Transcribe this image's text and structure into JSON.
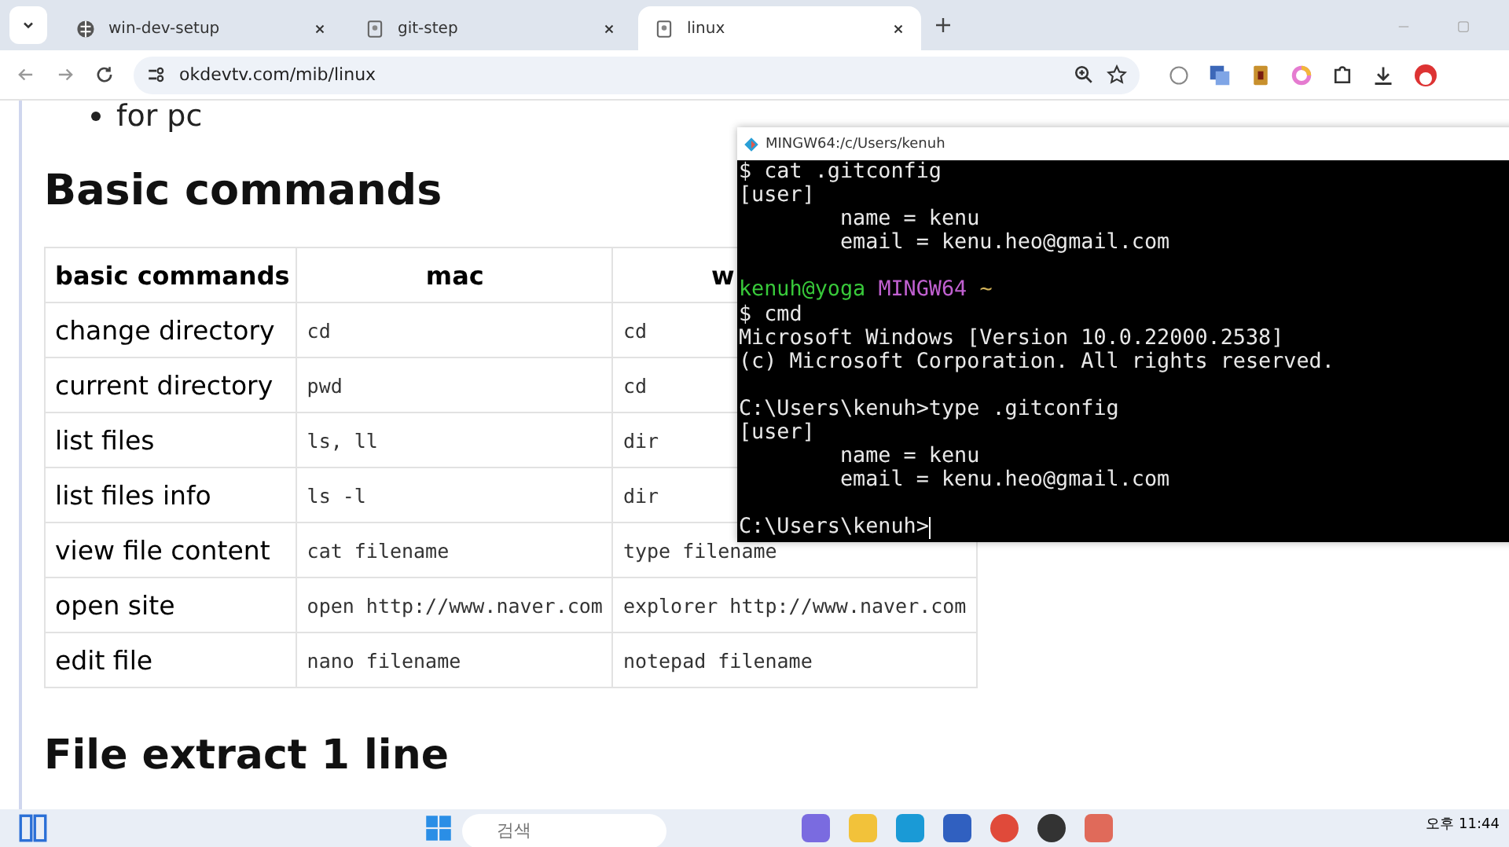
{
  "browser": {
    "tabs": [
      {
        "title": "win-dev-setup",
        "selected": false
      },
      {
        "title": "git-step",
        "selected": false
      },
      {
        "title": "linux",
        "selected": true
      }
    ],
    "address": "okdevtv.com/mib/linux"
  },
  "page": {
    "bullet": "for pc",
    "heading": "Basic commands",
    "table": {
      "columns": [
        "basic commands",
        "mac",
        "w"
      ],
      "rows": [
        [
          "change directory",
          "cd",
          "cd"
        ],
        [
          "current directory",
          "pwd",
          "cd"
        ],
        [
          "list files",
          "ls, ll",
          "dir"
        ],
        [
          "list files info",
          "ls -l",
          "dir"
        ],
        [
          "view file content",
          "cat filename",
          "type filename"
        ],
        [
          "open site",
          "open http://www.naver.com",
          "explorer http://www.naver.com"
        ],
        [
          "edit file",
          "nano filename",
          "notepad filename"
        ]
      ]
    },
    "heading_2": "File extract 1 line"
  },
  "terminal": {
    "title": "MINGW64:/c/Users/kenuh",
    "lines": [
      {
        "kind": "text",
        "text": "$ cat .gitconfig"
      },
      {
        "kind": "text",
        "text": "[user]"
      },
      {
        "kind": "text",
        "text": "        name = kenu"
      },
      {
        "kind": "text",
        "text": "        email = kenu.heo@gmail.com"
      },
      {
        "kind": "blank"
      },
      {
        "kind": "prompt",
        "user": "kenuh@yoga",
        "shell": "MINGW64",
        "dir": "~"
      },
      {
        "kind": "text",
        "text": "$ cmd"
      },
      {
        "kind": "text",
        "text": "Microsoft Windows [Version 10.0.22000.2538]"
      },
      {
        "kind": "text",
        "text": "(c) Microsoft Corporation. All rights reserved."
      },
      {
        "kind": "blank"
      },
      {
        "kind": "text",
        "text": "C:\\Users\\kenuh>type .gitconfig"
      },
      {
        "kind": "text",
        "text": "[user]"
      },
      {
        "kind": "text",
        "text": "        name = kenu"
      },
      {
        "kind": "text",
        "text": "        email = kenu.heo@gmail.com"
      },
      {
        "kind": "blank"
      },
      {
        "kind": "input",
        "text": "C:\\Users\\kenuh>"
      }
    ]
  },
  "taskbar": {
    "search": {
      "placeholder": "검색"
    },
    "clock": "오후 11:44"
  }
}
